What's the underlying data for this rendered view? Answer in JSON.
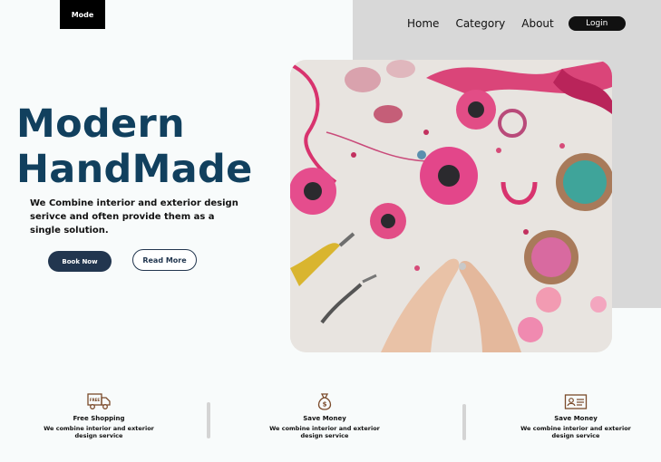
{
  "brand": {
    "logo_text": "Mode"
  },
  "nav": {
    "links": [
      "Home",
      "Category",
      "About"
    ],
    "login_label": "Login"
  },
  "hero": {
    "headline_line1": "Modern",
    "headline_line2": "HandMade",
    "subtext": "We Combine interior and exterior design serivce and often provide them as a single solution.",
    "book_label": "Book Now",
    "read_label": "Read More"
  },
  "features": [
    {
      "icon": "truck-icon",
      "title": "Free Shopping",
      "desc": "We combine interior and exterior design service"
    },
    {
      "icon": "money-bag-icon",
      "title": "Save Money",
      "desc": "We combine interior and exterior design service"
    },
    {
      "icon": "id-card-icon",
      "title": "Save Money",
      "desc": "We combine interior and exterior design service"
    }
  ],
  "colors": {
    "headline": "#11405e",
    "button_dark": "#22364f",
    "panel_gray": "#d8d8d8",
    "accent_pink": "#e0457b"
  }
}
